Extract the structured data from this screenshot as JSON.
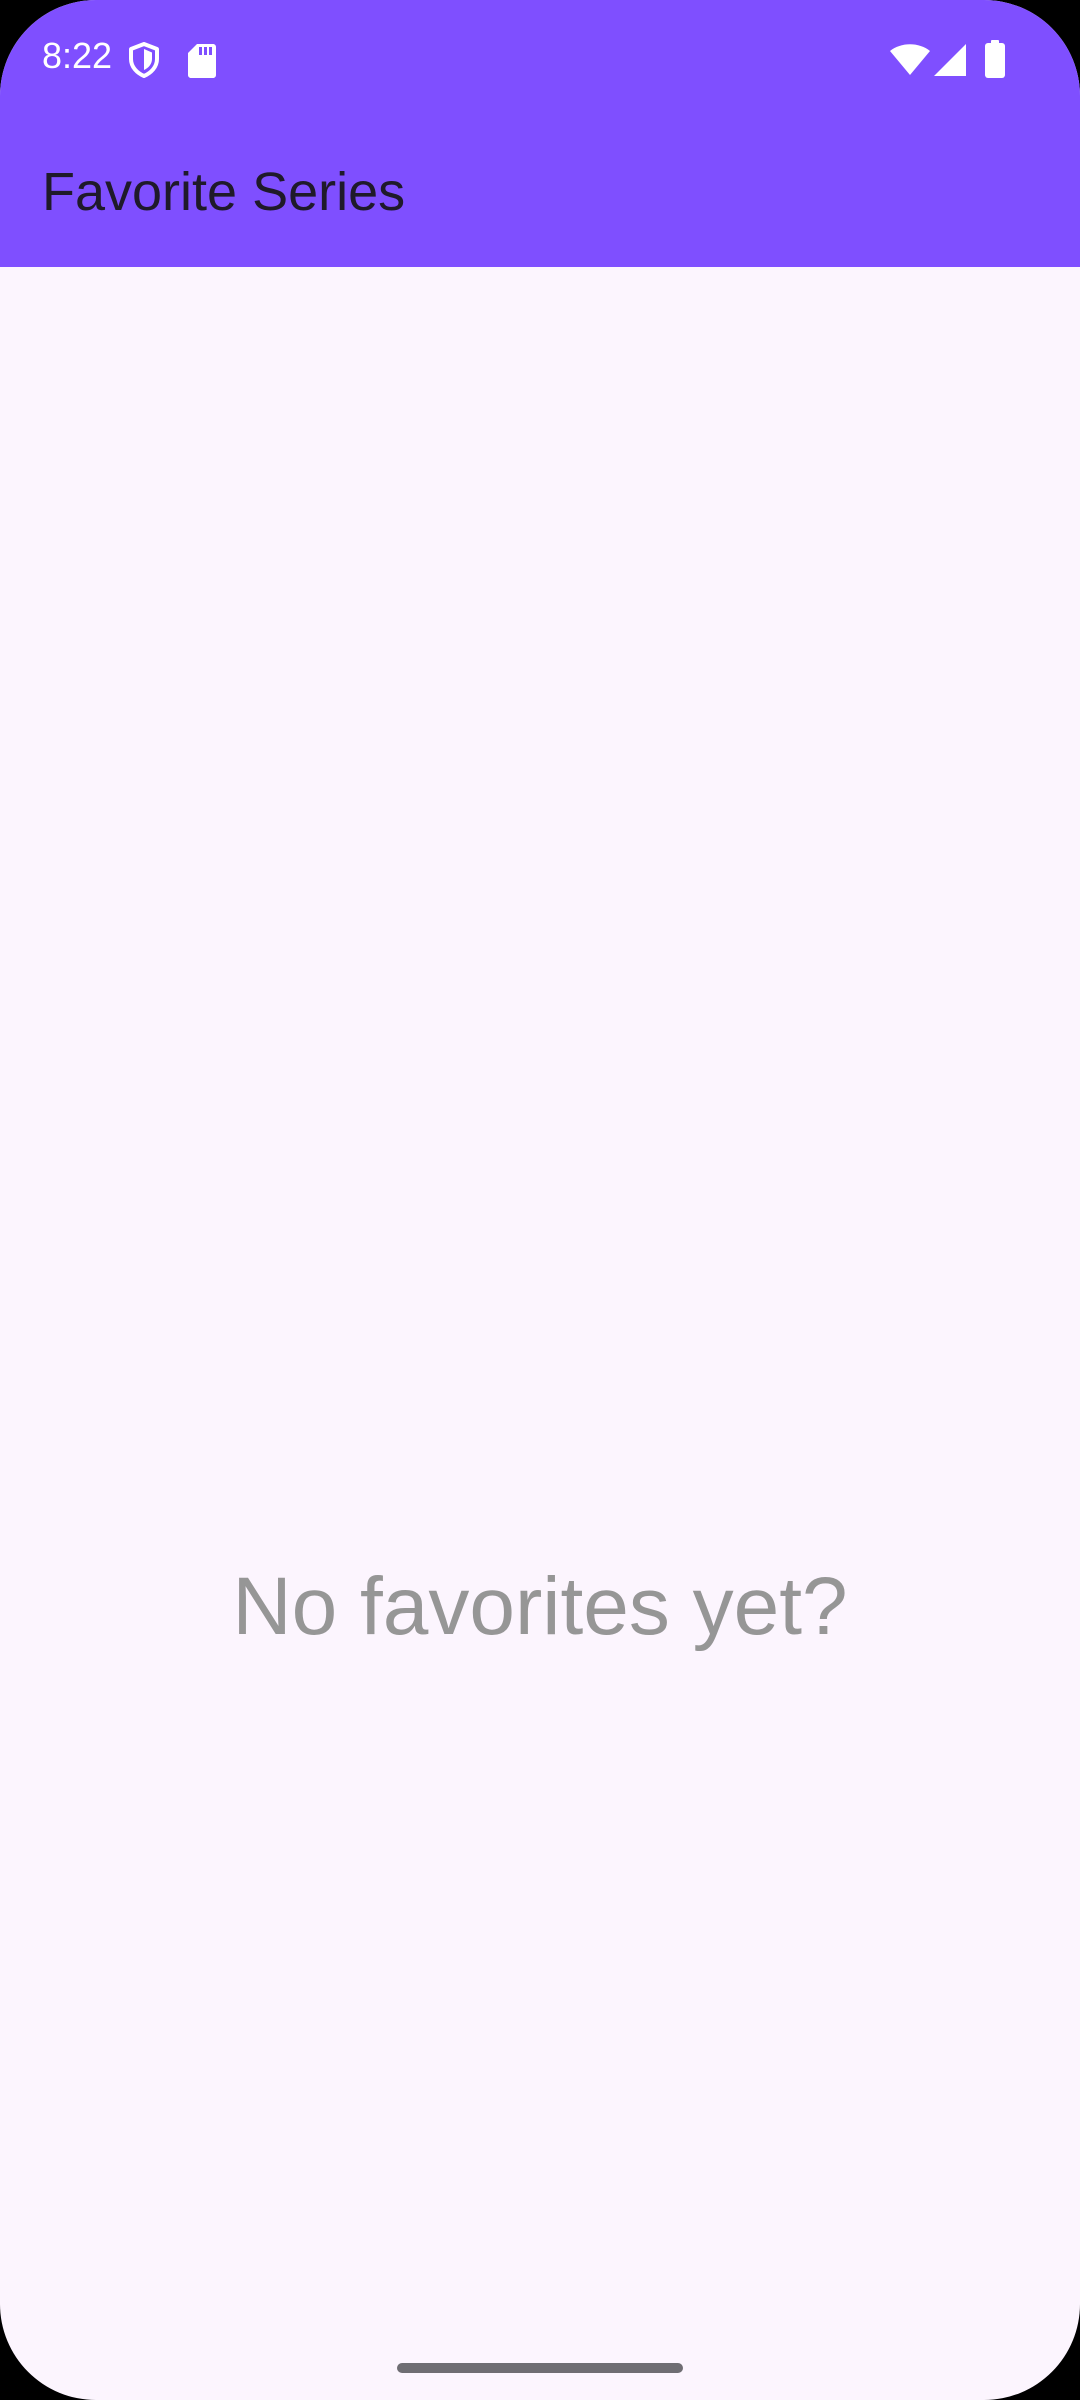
{
  "status_bar": {
    "time": "8:22",
    "left_icons": [
      "shield-icon",
      "sd-card-icon"
    ],
    "right_icons": [
      "wifi-icon",
      "cellular-signal-icon",
      "battery-icon"
    ]
  },
  "app_bar": {
    "title": "Favorite Series"
  },
  "main": {
    "empty_message": "No favorites yet?"
  },
  "colors": {
    "app_bar_background": "#7f4fff",
    "page_background": "#fcf5fe",
    "title_text": "#1f1a2a",
    "empty_text": "#969696"
  }
}
